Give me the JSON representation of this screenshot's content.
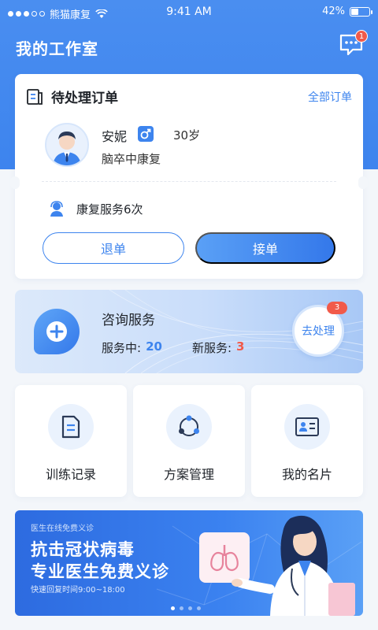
{
  "status_bar": {
    "carrier": "熊猫康复",
    "time": "9:41 AM",
    "battery": "42%",
    "battery_level": 0.42
  },
  "header": {
    "title": "我的工作室",
    "message_badge": "1"
  },
  "order_card": {
    "title": "待处理订单",
    "all_orders_link": "全部订单",
    "patient": {
      "name": "安妮",
      "gender": "male",
      "age": "30岁",
      "condition": "脑卒中康复"
    },
    "service_count": "康复服务6次",
    "refund_button": "退单",
    "accept_button": "接单"
  },
  "consult_card": {
    "title": "咨询服务",
    "in_service_label": "服务中:",
    "in_service_count": "20",
    "new_service_label": "新服务:",
    "new_service_count": "3",
    "process_button": "去处理",
    "process_badge": "3"
  },
  "tiles": [
    {
      "label": "训练记录",
      "icon": "document-icon"
    },
    {
      "label": "方案管理",
      "icon": "share-network-icon"
    },
    {
      "label": "我的名片",
      "icon": "id-card-icon"
    }
  ],
  "banner": {
    "small_text": "医生在线免费义诊",
    "line1": "抗击冠状病毒",
    "line2": "专业医生免费义诊",
    "sub_text": "快速回复时间9:00~18:00",
    "page_count": 4,
    "active_page": 1
  },
  "colors": {
    "primary": "#3d84ee",
    "badge": "#f15a4a",
    "background": "#f3f6fa"
  }
}
